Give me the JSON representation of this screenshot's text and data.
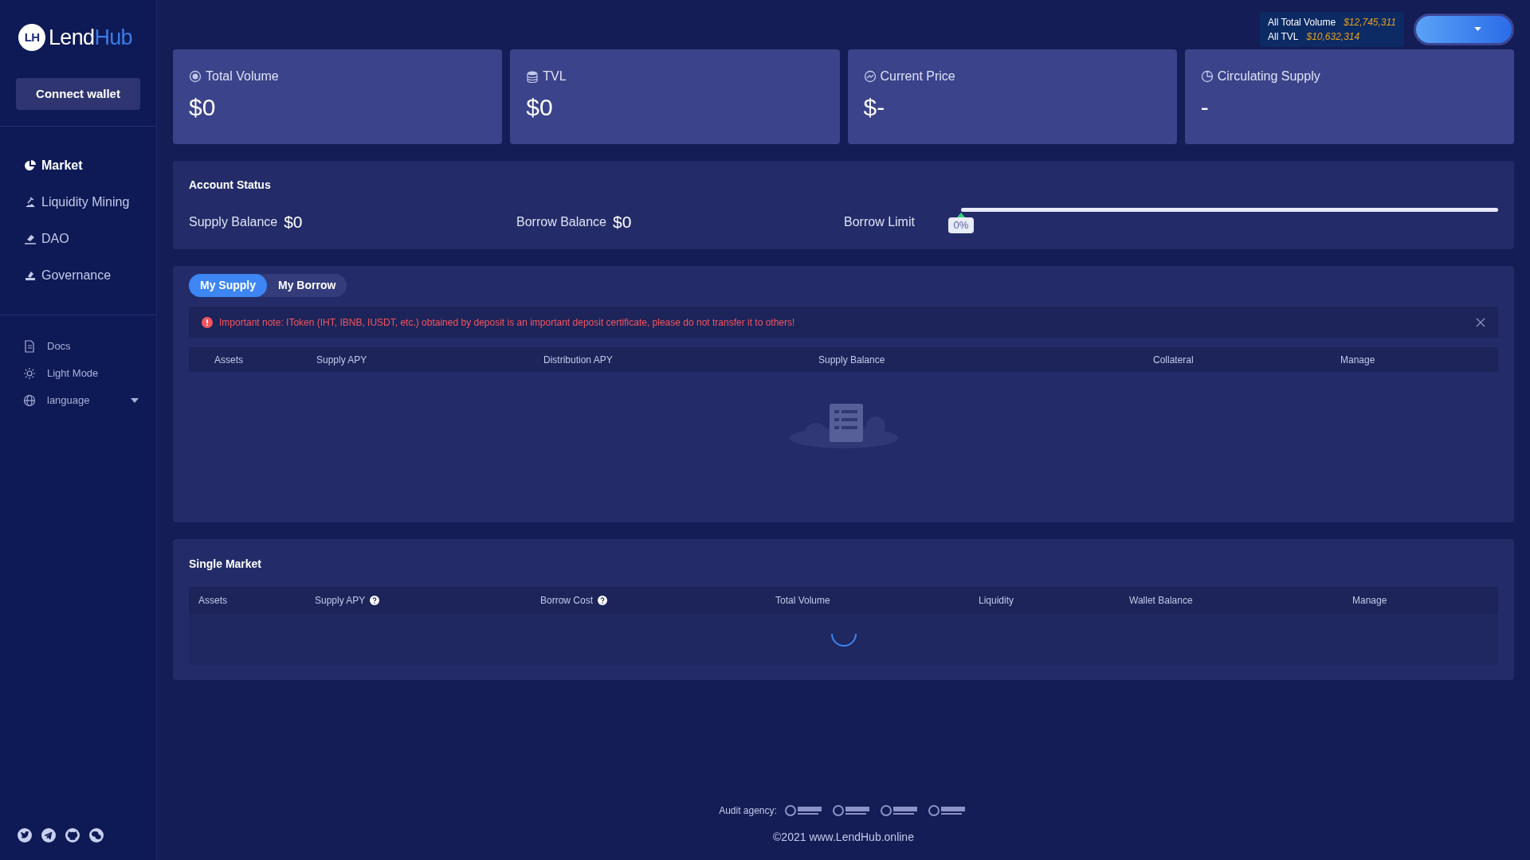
{
  "logo": {
    "mark": "LH",
    "word_left": "Lend",
    "word_right": "Hub"
  },
  "sidebar": {
    "connect_button": "Connect wallet",
    "nav": [
      {
        "label": "Market",
        "selected": true
      },
      {
        "label": "Liquidity Mining",
        "selected": false
      },
      {
        "label": "DAO",
        "selected": false
      },
      {
        "label": "Governance",
        "selected": false
      }
    ],
    "links": [
      {
        "label": "Docs",
        "kind": "link"
      },
      {
        "label": "Light Mode",
        "kind": "link"
      },
      {
        "label": "language",
        "kind": "dropdown"
      }
    ]
  },
  "header": {
    "totals": [
      {
        "label": "All Total Volume",
        "value": "$12,745,311"
      },
      {
        "label": "All TVL",
        "value": "$10,632,314"
      }
    ]
  },
  "stats": [
    {
      "title": "Total Volume",
      "value": "$0"
    },
    {
      "title": "TVL",
      "value": "$0"
    },
    {
      "title": "Current Price",
      "value": "$-"
    },
    {
      "title": "Circulating Supply",
      "value": "-"
    }
  ],
  "account_status": {
    "title": "Account Status",
    "supply_label": "Supply Balance",
    "supply_value": "$0",
    "borrow_label": "Borrow Balance",
    "borrow_value": "$0",
    "limit_label": "Borrow Limit",
    "level": 0,
    "reading": "0%"
  },
  "supply_panel": {
    "tabs": [
      {
        "label": "My Supply",
        "selected": true
      },
      {
        "label": "My Borrow",
        "selected": false
      }
    ],
    "note": "Important note: IToken (IHT, IBNB, IUSDT, etc.) obtained by deposit is an important deposit certificate, please do not transfer it to others!",
    "columns": [
      "Assets",
      "Supply APY",
      "Distribution APY",
      "Supply Balance",
      "Collateral",
      "Manage"
    ]
  },
  "single_market": {
    "title": "Single Market",
    "columns": [
      {
        "label": "Assets",
        "help": false
      },
      {
        "label": "Supply APY",
        "help": true
      },
      {
        "label": "Borrow Cost",
        "help": true
      },
      {
        "label": "Total Volume",
        "help": false
      },
      {
        "label": "Liquidity",
        "help": false
      },
      {
        "label": "Wallet Balance",
        "help": false
      },
      {
        "label": "Manage",
        "help": false
      }
    ]
  },
  "footer": {
    "audit_label": "Audit agency:",
    "copyright": "©2021 www.LendHub.online"
  }
}
